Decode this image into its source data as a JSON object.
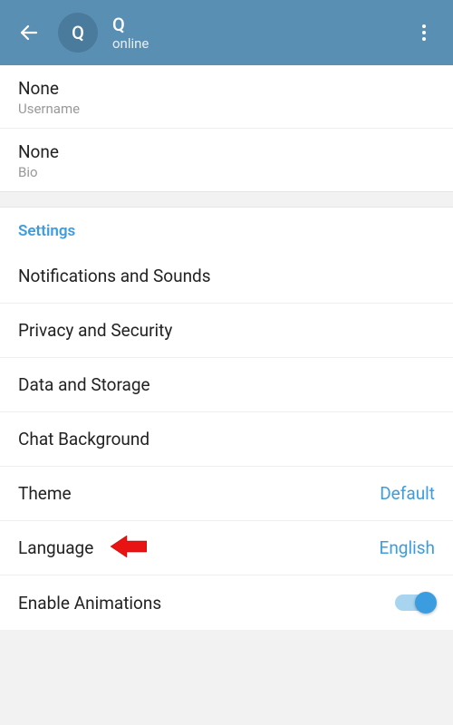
{
  "header": {
    "avatar_letter": "Q",
    "title": "Q",
    "status": "online"
  },
  "profile": {
    "username": {
      "value": "None",
      "label": "Username"
    },
    "bio": {
      "value": "None",
      "label": "Bio"
    }
  },
  "settings": {
    "header": "Settings",
    "items": [
      {
        "label": "Notifications and Sounds"
      },
      {
        "label": "Privacy and Security"
      },
      {
        "label": "Data and Storage"
      },
      {
        "label": "Chat Background"
      },
      {
        "label": "Theme",
        "value": "Default"
      },
      {
        "label": "Language",
        "value": "English"
      },
      {
        "label": "Enable Animations",
        "toggle": true
      }
    ]
  }
}
